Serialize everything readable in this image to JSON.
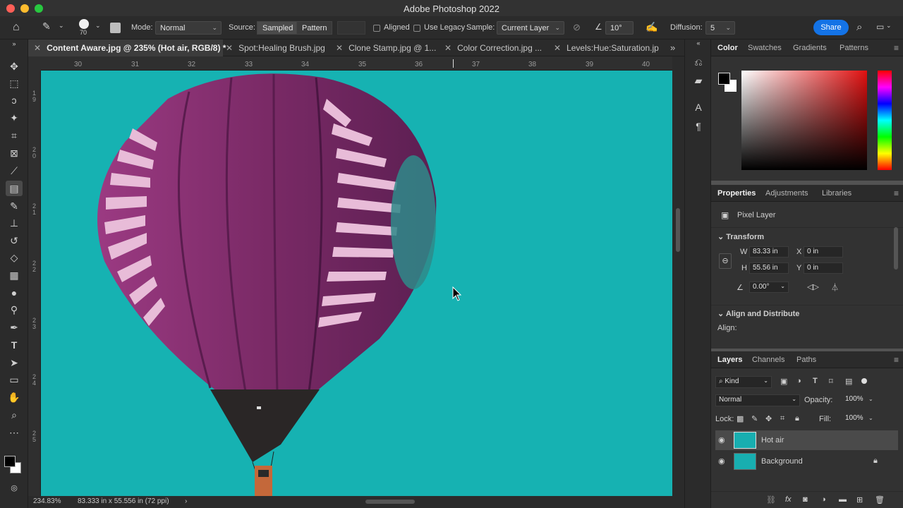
{
  "app": {
    "title": "Adobe Photoshop 2022"
  },
  "options": {
    "brush_size": "70",
    "mode_label": "Mode:",
    "mode_value": "Normal",
    "source_label": "Source:",
    "source_sampled": "Sampled",
    "source_pattern": "Pattern",
    "aligned_label": "Aligned",
    "legacy_label": "Use Legacy",
    "sample_label": "Sample:",
    "sample_value": "Current Layer",
    "angle_value": "10°",
    "diffusion_label": "Diffusion:",
    "diffusion_value": "5",
    "share_label": "Share"
  },
  "tabs": [
    {
      "label": "Content Aware.jpg @ 235% (Hot air, RGB/8) *"
    },
    {
      "label": "Spot:Healing Brush.jpg"
    },
    {
      "label": "Clone Stamp.jpg @ 1..."
    },
    {
      "label": "Color Correction.jpg ..."
    },
    {
      "label": "Levels:Hue:Saturation.jp"
    }
  ],
  "ruler": {
    "h_ticks": [
      "30",
      "31",
      "32",
      "33",
      "34",
      "35",
      "36",
      "37",
      "38",
      "39",
      "40"
    ],
    "v_ticks": [
      "1 9",
      "2 0",
      "2 1",
      "2 2",
      "2 3",
      "2 4",
      "2 5"
    ]
  },
  "status": {
    "zoom": "234.83%",
    "size": "83.333 in x 55.556 in (72 ppi)"
  },
  "color_panel": {
    "tabs": [
      "Color",
      "Swatches",
      "Gradients",
      "Patterns"
    ]
  },
  "properties": {
    "tabs": [
      "Properties",
      "Adjustments",
      "Libraries"
    ],
    "layer_type": "Pixel Layer",
    "transform_label": "Transform",
    "w_label": "W",
    "w_value": "83.33 in",
    "h_label": "H",
    "h_value": "55.56 in",
    "x_label": "X",
    "x_value": "0 in",
    "y_label": "Y",
    "y_value": "0 in",
    "angle_value": "0.00°",
    "align_label": "Align and Distribute",
    "align_sub": "Align:"
  },
  "layers_panel": {
    "tabs": [
      "Layers",
      "Channels",
      "Paths"
    ],
    "filter_kind": "Kind",
    "blend_mode": "Normal",
    "opacity_label": "Opacity:",
    "opacity_value": "100%",
    "lock_label": "Lock:",
    "fill_label": "Fill:",
    "fill_value": "100%",
    "layers": [
      {
        "name": "Hot air"
      },
      {
        "name": "Background"
      }
    ]
  },
  "colors": {
    "accent": "#1473e6",
    "canvas_sky": "#16b2b2",
    "balloon": "#7a2a66"
  }
}
